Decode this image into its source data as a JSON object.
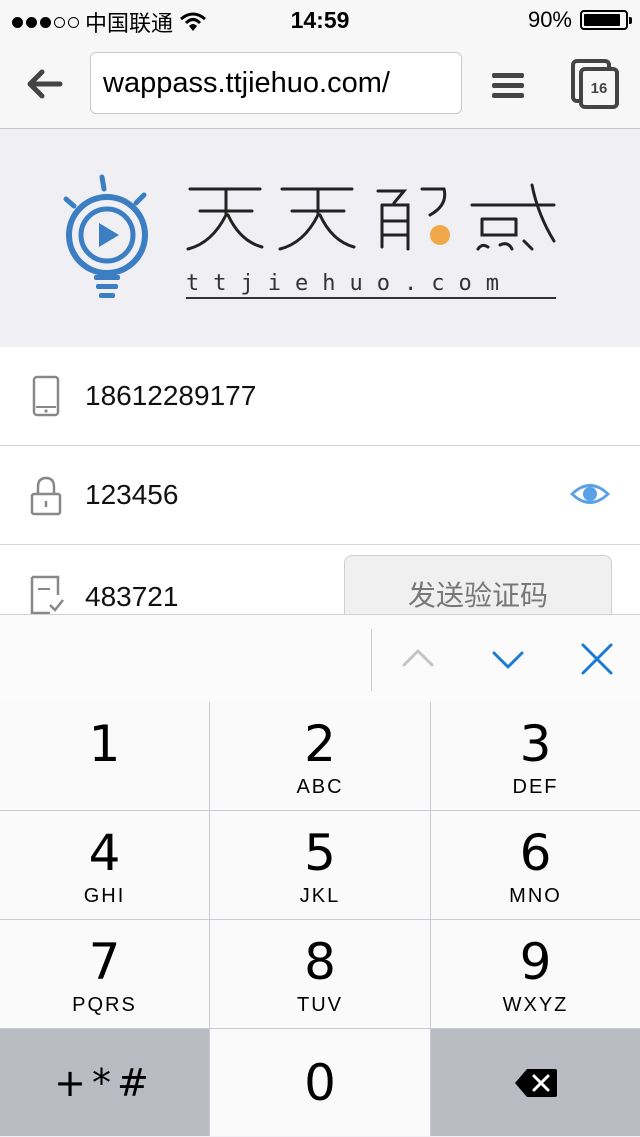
{
  "status": {
    "carrier": "中国联通",
    "time": "14:59",
    "battery": "90%",
    "battery_level": 0.9,
    "signal_bars_filled": 3,
    "signal_bars_total": 5
  },
  "browser": {
    "url": "wappass.ttjiehuo.com/",
    "tab_count": "16",
    "icons": [
      "back-arrow-icon",
      "menu-icon",
      "tabs-icon"
    ]
  },
  "logo": {
    "title": "天天解惑",
    "domain": "ttjiehuo.com",
    "colors": {
      "icon_blue": "#3c7ec2",
      "accent_orange": "#f0a84b",
      "text_dark": "#222222"
    }
  },
  "form": {
    "phone": "18612289177",
    "password": "123456",
    "code": "483721",
    "send_code_label": "发送验证码"
  },
  "keyboard": {
    "keys": [
      {
        "num": "1",
        "letters": ""
      },
      {
        "num": "2",
        "letters": "ABC"
      },
      {
        "num": "3",
        "letters": "DEF"
      },
      {
        "num": "4",
        "letters": "GHI"
      },
      {
        "num": "5",
        "letters": "JKL"
      },
      {
        "num": "6",
        "letters": "MNO"
      },
      {
        "num": "7",
        "letters": "PQRS"
      },
      {
        "num": "8",
        "letters": "TUV"
      },
      {
        "num": "9",
        "letters": "WXYZ"
      }
    ],
    "symbols_key": "+*#",
    "zero_key": "0",
    "colors": {
      "accessory_blue": "#1a7bd6",
      "eye_blue": "#5aa0e6"
    }
  }
}
